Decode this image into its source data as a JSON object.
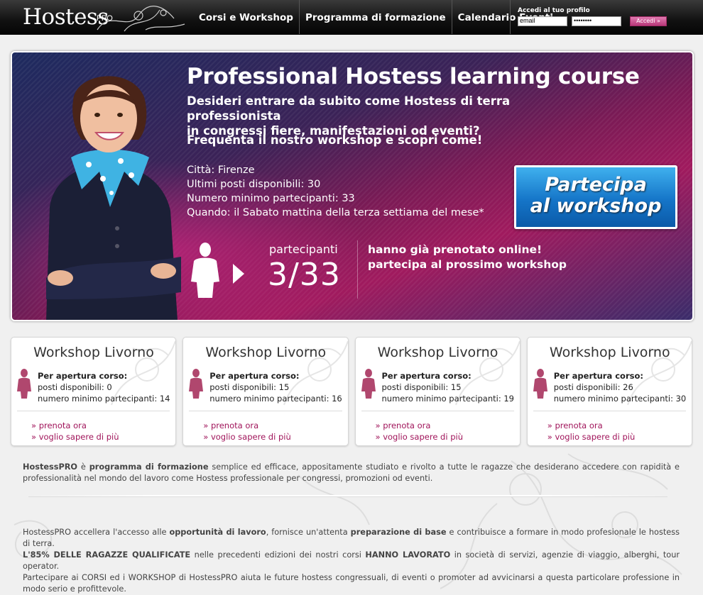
{
  "header": {
    "logo_text": "Hostess",
    "logo_sup": "PRO",
    "nav": [
      "Corsi e Workshop",
      "Programma di formazione",
      "Calendario Eventi"
    ],
    "login": {
      "title": "Accedi al tuo profilo",
      "email_value": "email",
      "password_value": "••••••••",
      "button": "Accedi »"
    }
  },
  "hero": {
    "title": "Professional Hostess learning course",
    "subtitle_line1": "Desideri entrare da subito come Hostess di terra professionista",
    "subtitle_line2": "in congressi fiere, manifestazioni od eventi?",
    "cta_text": "Frequenta il nostro workshop e scopri come!",
    "details": [
      "Città: Firenze",
      "Ultimi posti disponibili: 30",
      "Numero minimo partecipanti: 33",
      "Quando: il Sabato mattina della terza settiama del mese*"
    ],
    "button_line1": "Partecipa",
    "button_line2": "al workshop",
    "participants_label": "partecipanti",
    "participants_count": "3/33",
    "booked_line1": "hanno già prenotato online!",
    "booked_line2": "partecipa al prossimo workshop"
  },
  "cards": [
    {
      "title": "Workshop Livorno",
      "heading": "Per apertura corso:",
      "posti": "posti disponibili: 0",
      "minimo": "numero minimo partecipanti: 14",
      "link1": "prenota ora",
      "link2": "voglio sapere di più"
    },
    {
      "title": "Workshop Livorno",
      "heading": "Per apertura corso:",
      "posti": "posti disponibili: 15",
      "minimo": "numero minimo partecipanti: 16",
      "link1": "prenota ora",
      "link2": "voglio sapere di più"
    },
    {
      "title": "Workshop Livorno",
      "heading": "Per apertura corso:",
      "posti": "posti disponibili: 15",
      "minimo": "numero minimo partecipanti: 19",
      "link1": "prenota ora",
      "link2": "voglio sapere di più"
    },
    {
      "title": "Workshop Livorno",
      "heading": "Per apertura corso:",
      "posti": "posti disponibili: 26",
      "minimo": "numero minimo partecipanti: 30",
      "link1": "prenota ora",
      "link2": "voglio sapere di più"
    }
  ],
  "intro": {
    "brand": "HostessPRO",
    "t1": " è ",
    "b1": "programma di formazione",
    "t2": " semplice ed efficace,  appositamente studiato e rivolto a tutte le ragazze che desiderano accedere con rapidità e professionalità nel mondo del lavoro come Hostess professionale per congressi, promozioni od eventi."
  },
  "outro": {
    "p1_a": "HostessPRO accellera l'accesso alle ",
    "p1_b": "opportunità di lavoro",
    "p1_c": ", fornisce un'attenta ",
    "p1_d": "preparazione di base",
    "p1_e": " e contribuisce a formare in modo profesionale le hostess di terra.",
    "p2_a": "L'85% DELLE RAGAZZE QUALIFICATE",
    "p2_b": " nelle precedenti edizioni dei nostri corsi ",
    "p2_c": "HANNO LAVORATO",
    "p2_d": " in società di servizi, agenzie di viaggio, alberghi, tour operator.",
    "p3": "Partecipare ai CORSI ed i WORKSHOP di HostessPRO aiuta le future hostess congressuali, di eventi o promoter ad avvicinarsi a questa particolare professione in modo serio e profittevole."
  },
  "colors": {
    "accent": "#a0145a",
    "button_blue": "#1575c8",
    "topbar": "#111111"
  }
}
